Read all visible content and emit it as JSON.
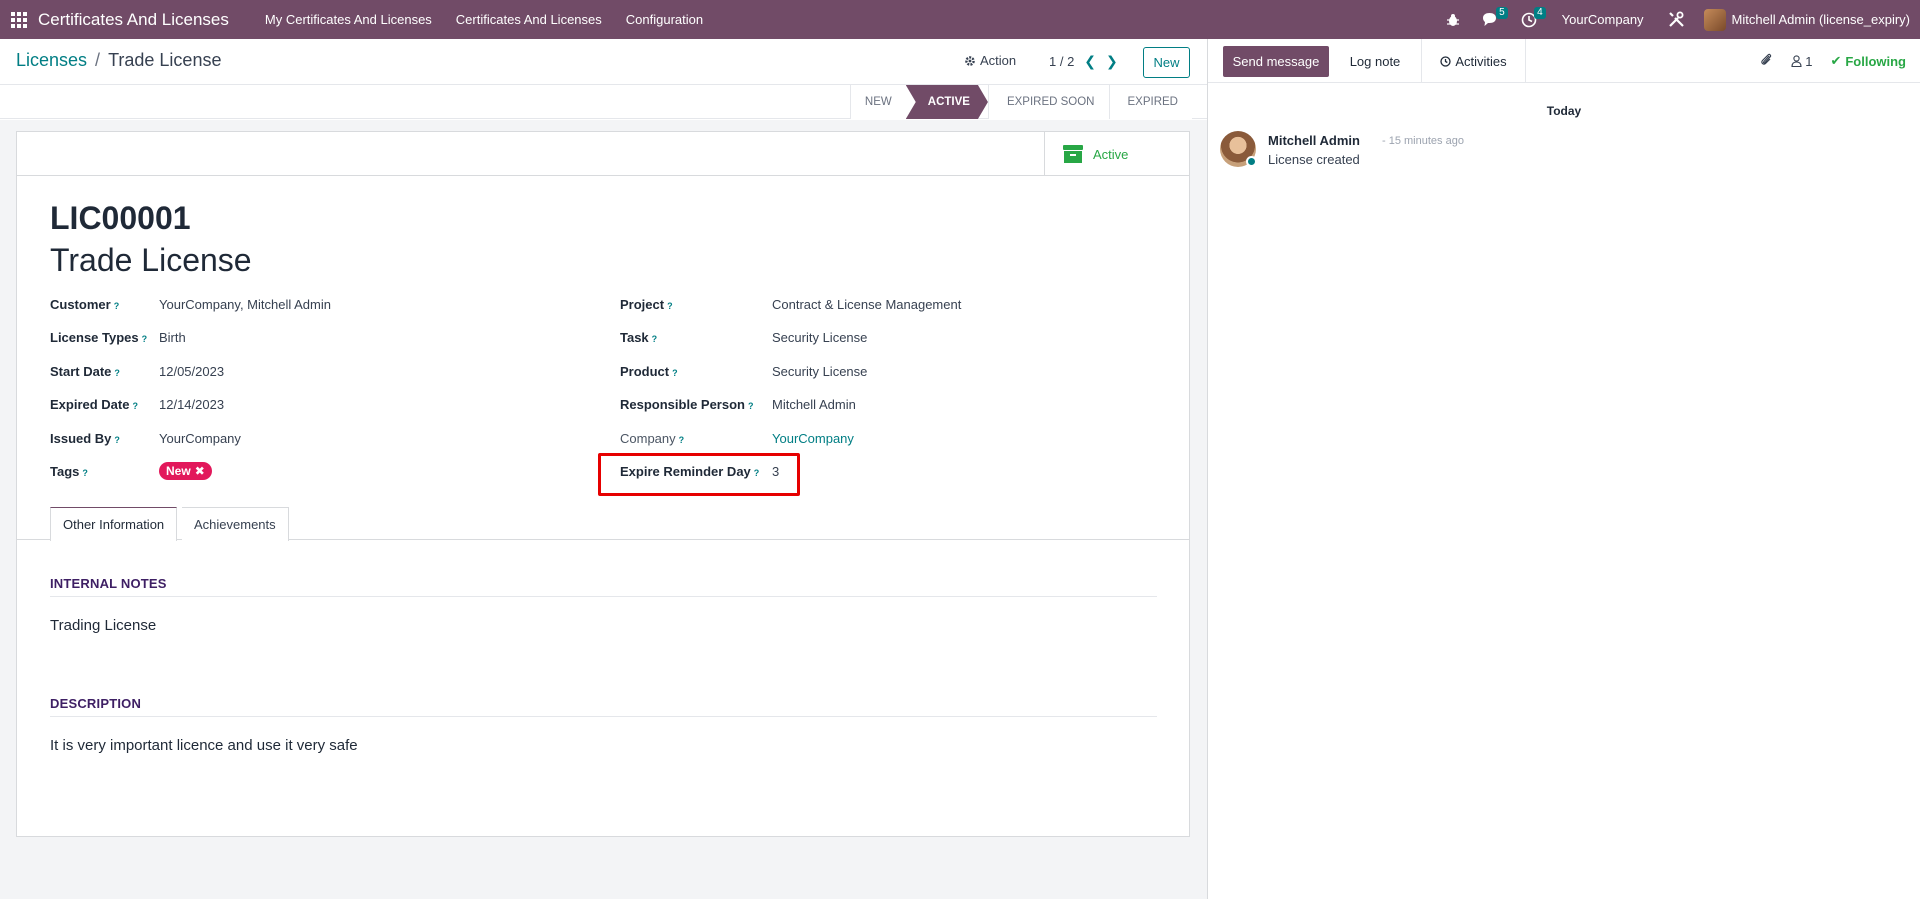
{
  "navbar": {
    "app_title": "Certificates And Licenses",
    "menu": [
      "My Certificates And Licenses",
      "Certificates And Licenses",
      "Configuration"
    ],
    "messages_badge": "5",
    "activities_badge": "4",
    "company": "YourCompany",
    "user": "Mitchell Admin (license_expiry)"
  },
  "control": {
    "breadcrumb_parent": "Licenses",
    "breadcrumb_sep": "/",
    "breadcrumb_current": "Trade License",
    "action_label": "Action",
    "pager": "1 / 2",
    "new_label": "New"
  },
  "statusbar": {
    "stages": [
      "NEW",
      "ACTIVE",
      "EXPIRED SOON",
      "EXPIRED"
    ],
    "active_stage": "ACTIVE"
  },
  "form": {
    "smart_button_label": "Active",
    "reference": "LIC00001",
    "name": "Trade License",
    "left_fields": [
      {
        "label": "Customer",
        "value": "YourCompany, Mitchell Admin"
      },
      {
        "label": "License Types",
        "value": "Birth"
      },
      {
        "label": "Start Date",
        "value": "12/05/2023"
      },
      {
        "label": "Expired Date",
        "value": "12/14/2023"
      },
      {
        "label": "Issued By",
        "value": "YourCompany"
      },
      {
        "label": "Tags",
        "value": ""
      }
    ],
    "tag_value": "New",
    "right_fields": [
      {
        "label": "Project",
        "value": "Contract & License Management"
      },
      {
        "label": "Task",
        "value": "Security License"
      },
      {
        "label": "Product",
        "value": "Security License"
      },
      {
        "label": "Responsible Person",
        "value": "Mitchell Admin"
      },
      {
        "label": "Company",
        "value": "YourCompany"
      },
      {
        "label": "Expire Reminder Day",
        "value": "3"
      }
    ],
    "help_mark": "?",
    "tabs": [
      "Other Information",
      "Achievements"
    ],
    "internal_notes_title": "INTERNAL NOTES",
    "internal_notes": "Trading License",
    "description_title": "DESCRIPTION",
    "description": "It is very important licence and use it very safe"
  },
  "chatter": {
    "send_message": "Send message",
    "log_note": "Log note",
    "activities": "Activities",
    "followers_count": "1",
    "following": "Following",
    "date_separator": "Today",
    "message": {
      "author": "Mitchell Admin",
      "time": "- 15 minutes ago",
      "body": "License created"
    }
  },
  "colors": {
    "brand": "#714b67",
    "link": "#017e84",
    "success": "#28a745",
    "tag": "#e2185b",
    "highlight": "#e60000"
  }
}
